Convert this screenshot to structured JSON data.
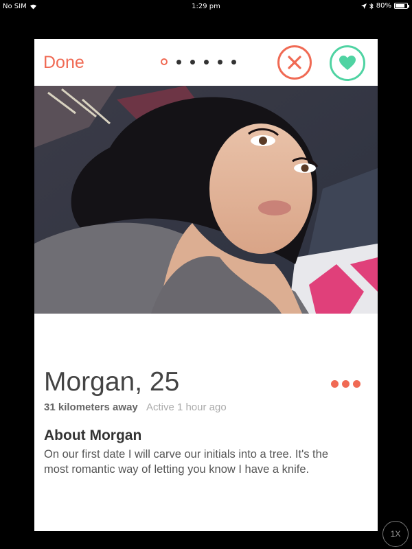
{
  "status_bar": {
    "carrier": "No SIM",
    "time": "1:29 pm",
    "battery": "80%",
    "battery_level": 0.8
  },
  "header": {
    "done_label": "Done",
    "page_count": 6,
    "active_page": 1
  },
  "colors": {
    "accent": "#f06a54",
    "like": "#4fd3a2"
  },
  "profile": {
    "name_age": "Morgan, 25",
    "distance": "31 kilometers away",
    "last_active": "Active 1 hour ago",
    "about_title": "About Morgan",
    "bio": "On our first date I will carve our initials into a tree. It's the most romantic way of letting you know I have a knife."
  },
  "zoom_label": "1X"
}
